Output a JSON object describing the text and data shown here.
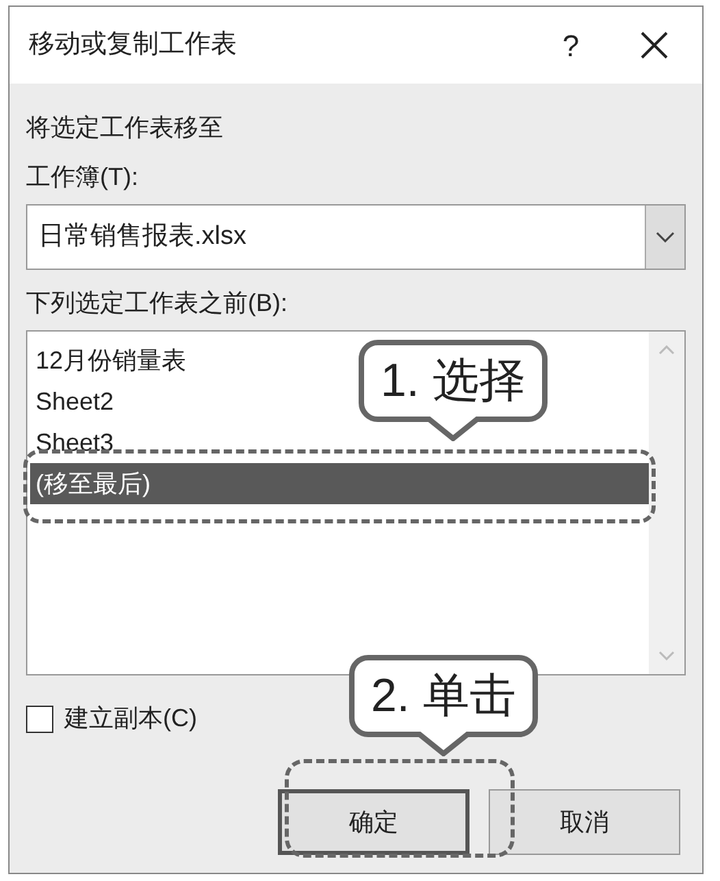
{
  "window": {
    "title": "移动或复制工作表",
    "help": "?"
  },
  "instruction": "将选定工作表移至",
  "workbook": {
    "label": "工作簿(T):",
    "value": "日常销售报表.xlsx"
  },
  "before_sheet": {
    "label": "下列选定工作表之前(B):",
    "items": [
      {
        "label": "12月份销量表",
        "selected": false
      },
      {
        "label": "Sheet2",
        "selected": false
      },
      {
        "label": "Sheet3",
        "selected": false
      },
      {
        "label": "(移至最后)",
        "selected": true
      }
    ]
  },
  "create_copy": {
    "label": "建立副本(C)",
    "checked": false
  },
  "buttons": [
    "确定",
    "取消"
  ],
  "callouts": [
    {
      "text": "1. 选择"
    },
    {
      "text": "2. 单击"
    }
  ]
}
